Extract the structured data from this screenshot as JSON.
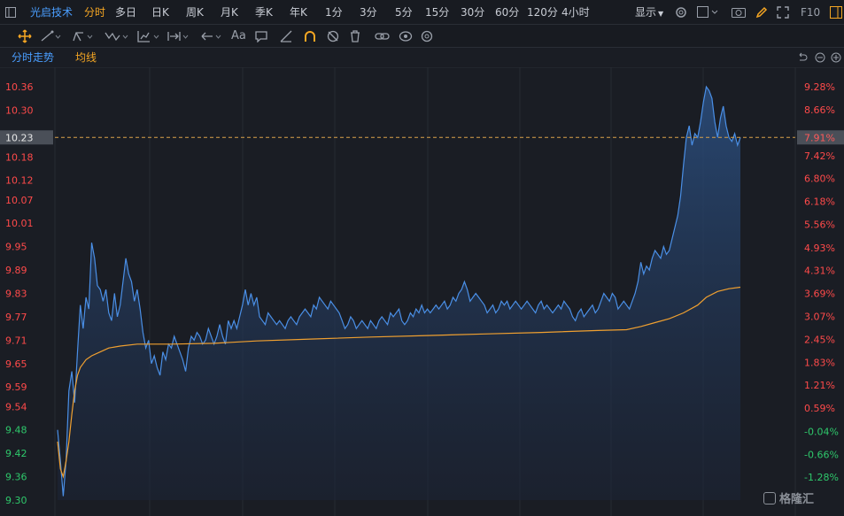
{
  "header": {
    "stock_name": "光启技术",
    "tabs": [
      "分时",
      "多日",
      "日K",
      "周K",
      "月K",
      "季K",
      "年K",
      "1分",
      "3分",
      "5分",
      "15分",
      "30分",
      "60分",
      "120分",
      "4小时"
    ],
    "active_tab": "分时",
    "display_label": "显示",
    "f10_label": "F10"
  },
  "toolbar": {
    "icons": [
      "move-icon",
      "line-icon",
      "trend-icon",
      "wave-icon",
      "chart-tool-icon",
      "range-icon",
      "arrow-icon",
      "text-icon",
      "comment-icon",
      "ruler-icon",
      "magnet-icon",
      "hide-icon",
      "trash-icon",
      "link-icon",
      "eye-icon",
      "settings-icon"
    ],
    "text_tool_label": "Aa"
  },
  "legend": {
    "price_label": "分时走势",
    "avg_label": "均线"
  },
  "watermark": "格隆汇",
  "colors": {
    "price_line": "#4a8fe6",
    "avg_line": "#f0a030",
    "up": "#ff4a4a",
    "down": "#2ec86b",
    "active_tab": "#f5a623"
  },
  "chart_data": {
    "type": "line",
    "title": "",
    "prev_close": 9.48,
    "current_price": "10.23",
    "current_pct": "7.91%",
    "y_ticks": [
      "10.36",
      "10.30",
      "10.23",
      "10.18",
      "10.12",
      "10.07",
      "10.01",
      "9.95",
      "9.89",
      "9.83",
      "9.77",
      "9.71",
      "9.65",
      "9.59",
      "9.54",
      "9.48",
      "9.42",
      "9.36",
      "9.30"
    ],
    "pct_ticks": [
      "9.28%",
      "8.66%",
      "7.91%",
      "7.42%",
      "6.80%",
      "6.18%",
      "5.56%",
      "4.93%",
      "4.31%",
      "3.69%",
      "3.07%",
      "2.45%",
      "1.83%",
      "1.21%",
      "0.59%",
      "-0.04%",
      "-0.66%",
      "-1.28%"
    ],
    "ylim": [
      9.3,
      10.36
    ],
    "x_count": 241,
    "series": [
      {
        "name": "分时走势",
        "points": [
          [
            0,
            9.48
          ],
          [
            1,
            9.4
          ],
          [
            2,
            9.31
          ],
          [
            3,
            9.4
          ],
          [
            4,
            9.58
          ],
          [
            5,
            9.63
          ],
          [
            6,
            9.55
          ],
          [
            7,
            9.68
          ],
          [
            8,
            9.8
          ],
          [
            9,
            9.74
          ],
          [
            10,
            9.82
          ],
          [
            11,
            9.79
          ],
          [
            12,
            9.96
          ],
          [
            13,
            9.92
          ],
          [
            14,
            9.85
          ],
          [
            15,
            9.84
          ],
          [
            16,
            9.81
          ],
          [
            17,
            9.84
          ],
          [
            18,
            9.78
          ],
          [
            19,
            9.76
          ],
          [
            20,
            9.83
          ],
          [
            21,
            9.77
          ],
          [
            22,
            9.8
          ],
          [
            23,
            9.86
          ],
          [
            24,
            9.92
          ],
          [
            25,
            9.88
          ],
          [
            26,
            9.86
          ],
          [
            27,
            9.81
          ],
          [
            28,
            9.84
          ],
          [
            29,
            9.79
          ],
          [
            30,
            9.73
          ],
          [
            31,
            9.69
          ],
          [
            32,
            9.71
          ],
          [
            33,
            9.65
          ],
          [
            34,
            9.67
          ],
          [
            35,
            9.64
          ],
          [
            36,
            9.62
          ],
          [
            37,
            9.68
          ],
          [
            38,
            9.66
          ],
          [
            39,
            9.7
          ],
          [
            40,
            9.69
          ],
          [
            41,
            9.72
          ],
          [
            42,
            9.7
          ],
          [
            43,
            9.68
          ],
          [
            44,
            9.66
          ],
          [
            45,
            9.63
          ],
          [
            46,
            9.69
          ],
          [
            47,
            9.72
          ],
          [
            48,
            9.71
          ],
          [
            49,
            9.73
          ],
          [
            50,
            9.72
          ],
          [
            51,
            9.7
          ],
          [
            52,
            9.71
          ],
          [
            53,
            9.74
          ],
          [
            54,
            9.72
          ],
          [
            55,
            9.7
          ],
          [
            56,
            9.72
          ],
          [
            57,
            9.75
          ],
          [
            58,
            9.72
          ],
          [
            59,
            9.7
          ],
          [
            60,
            9.76
          ],
          [
            61,
            9.74
          ],
          [
            62,
            9.76
          ],
          [
            63,
            9.74
          ],
          [
            64,
            9.77
          ],
          [
            65,
            9.8
          ],
          [
            66,
            9.84
          ],
          [
            67,
            9.8
          ],
          [
            68,
            9.83
          ],
          [
            69,
            9.8
          ],
          [
            70,
            9.82
          ],
          [
            71,
            9.77
          ],
          [
            72,
            9.76
          ],
          [
            73,
            9.75
          ],
          [
            74,
            9.78
          ],
          [
            75,
            9.77
          ],
          [
            76,
            9.76
          ],
          [
            77,
            9.75
          ],
          [
            78,
            9.76
          ],
          [
            79,
            9.75
          ],
          [
            80,
            9.74
          ],
          [
            81,
            9.76
          ],
          [
            82,
            9.77
          ],
          [
            83,
            9.76
          ],
          [
            84,
            9.75
          ],
          [
            85,
            9.77
          ],
          [
            86,
            9.78
          ],
          [
            87,
            9.79
          ],
          [
            88,
            9.78
          ],
          [
            89,
            9.77
          ],
          [
            90,
            9.8
          ],
          [
            91,
            9.79
          ],
          [
            92,
            9.82
          ],
          [
            93,
            9.81
          ],
          [
            94,
            9.8
          ],
          [
            95,
            9.79
          ],
          [
            96,
            9.81
          ],
          [
            97,
            9.8
          ],
          [
            98,
            9.79
          ],
          [
            99,
            9.78
          ],
          [
            100,
            9.76
          ],
          [
            101,
            9.74
          ],
          [
            102,
            9.75
          ],
          [
            103,
            9.77
          ],
          [
            104,
            9.76
          ],
          [
            105,
            9.74
          ],
          [
            106,
            9.75
          ],
          [
            107,
            9.76
          ],
          [
            108,
            9.75
          ],
          [
            109,
            9.74
          ],
          [
            110,
            9.76
          ],
          [
            111,
            9.75
          ],
          [
            112,
            9.74
          ],
          [
            113,
            9.76
          ],
          [
            114,
            9.77
          ],
          [
            115,
            9.76
          ],
          [
            116,
            9.75
          ],
          [
            117,
            9.78
          ],
          [
            118,
            9.77
          ],
          [
            119,
            9.78
          ],
          [
            120,
            9.79
          ],
          [
            121,
            9.76
          ],
          [
            122,
            9.75
          ],
          [
            123,
            9.76
          ],
          [
            124,
            9.78
          ],
          [
            125,
            9.77
          ],
          [
            126,
            9.79
          ],
          [
            127,
            9.78
          ],
          [
            128,
            9.8
          ],
          [
            129,
            9.78
          ],
          [
            130,
            9.79
          ],
          [
            131,
            9.78
          ],
          [
            132,
            9.79
          ],
          [
            133,
            9.8
          ],
          [
            134,
            9.79
          ],
          [
            135,
            9.8
          ],
          [
            136,
            9.81
          ],
          [
            137,
            9.79
          ],
          [
            138,
            9.8
          ],
          [
            139,
            9.82
          ],
          [
            140,
            9.81
          ],
          [
            141,
            9.83
          ],
          [
            142,
            9.84
          ],
          [
            143,
            9.86
          ],
          [
            144,
            9.84
          ],
          [
            145,
            9.81
          ],
          [
            146,
            9.82
          ],
          [
            147,
            9.83
          ],
          [
            148,
            9.82
          ],
          [
            149,
            9.81
          ],
          [
            150,
            9.8
          ],
          [
            151,
            9.78
          ],
          [
            152,
            9.79
          ],
          [
            153,
            9.8
          ],
          [
            154,
            9.78
          ],
          [
            155,
            9.79
          ],
          [
            156,
            9.81
          ],
          [
            157,
            9.8
          ],
          [
            158,
            9.81
          ],
          [
            159,
            9.79
          ],
          [
            160,
            9.8
          ],
          [
            161,
            9.81
          ],
          [
            162,
            9.8
          ],
          [
            163,
            9.79
          ],
          [
            164,
            9.8
          ],
          [
            165,
            9.81
          ],
          [
            166,
            9.8
          ],
          [
            167,
            9.79
          ],
          [
            168,
            9.78
          ],
          [
            169,
            9.8
          ],
          [
            170,
            9.81
          ],
          [
            171,
            9.79
          ],
          [
            172,
            9.8
          ],
          [
            173,
            9.79
          ],
          [
            174,
            9.78
          ],
          [
            175,
            9.79
          ],
          [
            176,
            9.8
          ],
          [
            177,
            9.79
          ],
          [
            178,
            9.81
          ],
          [
            179,
            9.8
          ],
          [
            180,
            9.79
          ],
          [
            181,
            9.77
          ],
          [
            182,
            9.76
          ],
          [
            183,
            9.78
          ],
          [
            184,
            9.79
          ],
          [
            185,
            9.77
          ],
          [
            186,
            9.78
          ],
          [
            187,
            9.79
          ],
          [
            188,
            9.8
          ],
          [
            189,
            9.78
          ],
          [
            190,
            9.79
          ],
          [
            191,
            9.81
          ],
          [
            192,
            9.83
          ],
          [
            193,
            9.82
          ],
          [
            194,
            9.81
          ],
          [
            195,
            9.83
          ],
          [
            196,
            9.82
          ],
          [
            197,
            9.79
          ],
          [
            198,
            9.8
          ],
          [
            199,
            9.81
          ],
          [
            200,
            9.8
          ],
          [
            201,
            9.79
          ],
          [
            202,
            9.81
          ],
          [
            203,
            9.83
          ],
          [
            204,
            9.86
          ],
          [
            205,
            9.91
          ],
          [
            206,
            9.88
          ],
          [
            207,
            9.9
          ],
          [
            208,
            9.89
          ],
          [
            209,
            9.92
          ],
          [
            210,
            9.94
          ],
          [
            211,
            9.93
          ],
          [
            212,
            9.92
          ],
          [
            213,
            9.95
          ],
          [
            214,
            9.93
          ],
          [
            215,
            9.94
          ],
          [
            216,
            9.97
          ],
          [
            217,
            10.0
          ],
          [
            218,
            10.03
          ],
          [
            219,
            10.08
          ],
          [
            220,
            10.16
          ],
          [
            221,
            10.23
          ],
          [
            222,
            10.26
          ],
          [
            223,
            10.21
          ],
          [
            224,
            10.24
          ],
          [
            225,
            10.23
          ],
          [
            226,
            10.27
          ],
          [
            227,
            10.32
          ],
          [
            228,
            10.36
          ],
          [
            229,
            10.35
          ],
          [
            230,
            10.33
          ],
          [
            231,
            10.27
          ],
          [
            232,
            10.23
          ],
          [
            233,
            10.28
          ],
          [
            234,
            10.31
          ],
          [
            235,
            10.26
          ],
          [
            236,
            10.23
          ],
          [
            237,
            10.22
          ],
          [
            238,
            10.24
          ],
          [
            239,
            10.21
          ],
          [
            240,
            10.23
          ]
        ]
      },
      {
        "name": "均线",
        "points": [
          [
            0,
            9.45
          ],
          [
            1,
            9.38
          ],
          [
            2,
            9.36
          ],
          [
            3,
            9.4
          ],
          [
            4,
            9.45
          ],
          [
            5,
            9.52
          ],
          [
            6,
            9.58
          ],
          [
            7,
            9.62
          ],
          [
            8,
            9.64
          ],
          [
            9,
            9.65
          ],
          [
            10,
            9.66
          ],
          [
            12,
            9.67
          ],
          [
            15,
            9.68
          ],
          [
            18,
            9.69
          ],
          [
            22,
            9.695
          ],
          [
            28,
            9.7
          ],
          [
            40,
            9.7
          ],
          [
            55,
            9.702
          ],
          [
            70,
            9.708
          ],
          [
            90,
            9.713
          ],
          [
            110,
            9.718
          ],
          [
            130,
            9.722
          ],
          [
            150,
            9.726
          ],
          [
            170,
            9.73
          ],
          [
            190,
            9.735
          ],
          [
            200,
            9.737
          ],
          [
            205,
            9.745
          ],
          [
            210,
            9.755
          ],
          [
            215,
            9.765
          ],
          [
            220,
            9.78
          ],
          [
            225,
            9.8
          ],
          [
            228,
            9.82
          ],
          [
            232,
            9.835
          ],
          [
            236,
            9.842
          ],
          [
            240,
            9.846
          ]
        ]
      }
    ]
  }
}
